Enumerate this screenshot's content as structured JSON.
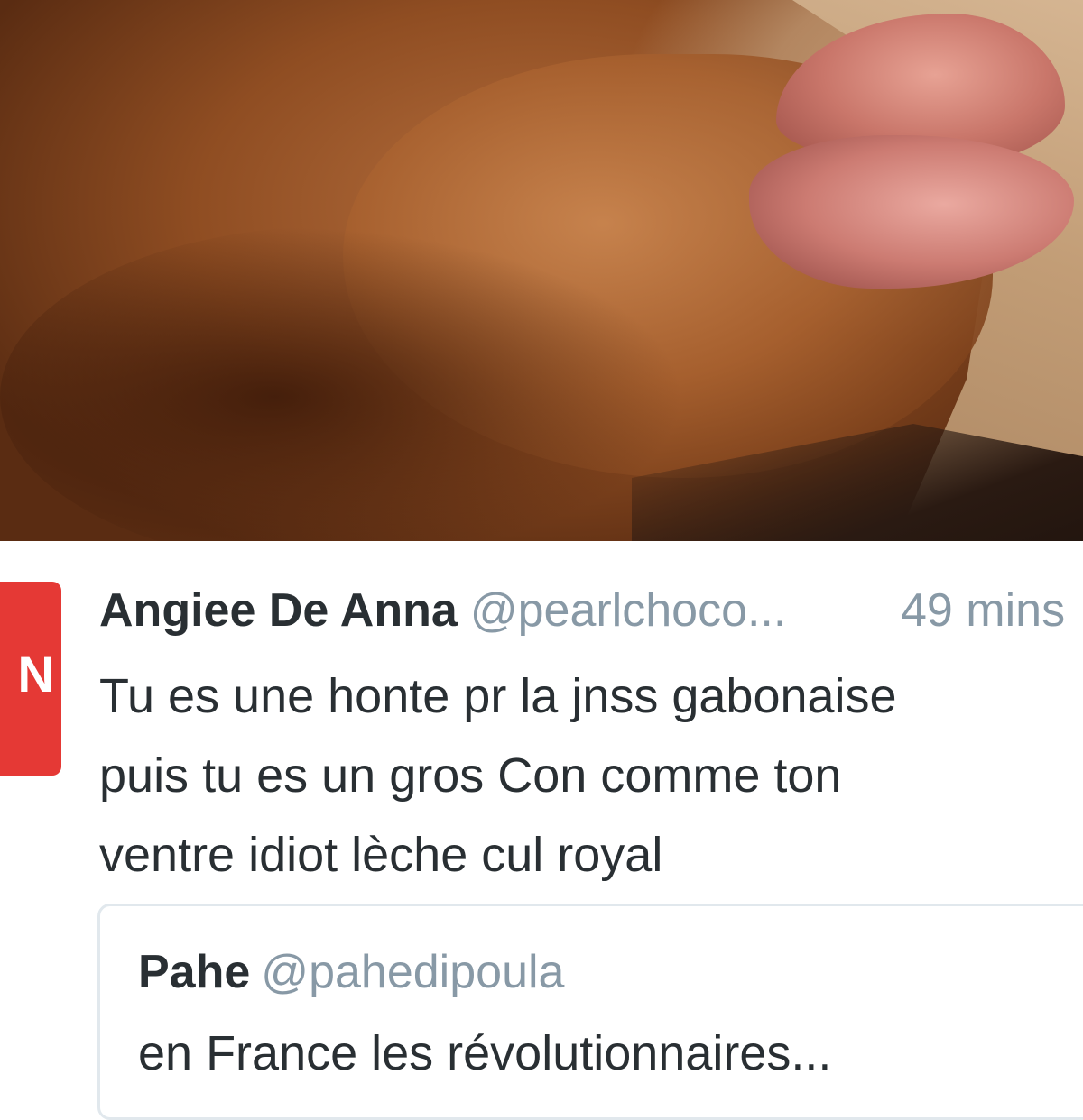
{
  "tweet": {
    "avatar_letter": "N",
    "avatar_color": "#e53935",
    "display_name": "Angiee De Anna",
    "handle": "@pearlchoco...",
    "time": "49 mins",
    "lines": [
      "Tu es une honte pr la jnss gabonaise",
      "puis tu es un gros Con comme ton",
      "ventre idiot lèche cul royal"
    ]
  },
  "quoted_tweet": {
    "display_name": "Pahe",
    "handle": "@pahedipoula",
    "text": "en France les révolutionnaires..."
  }
}
